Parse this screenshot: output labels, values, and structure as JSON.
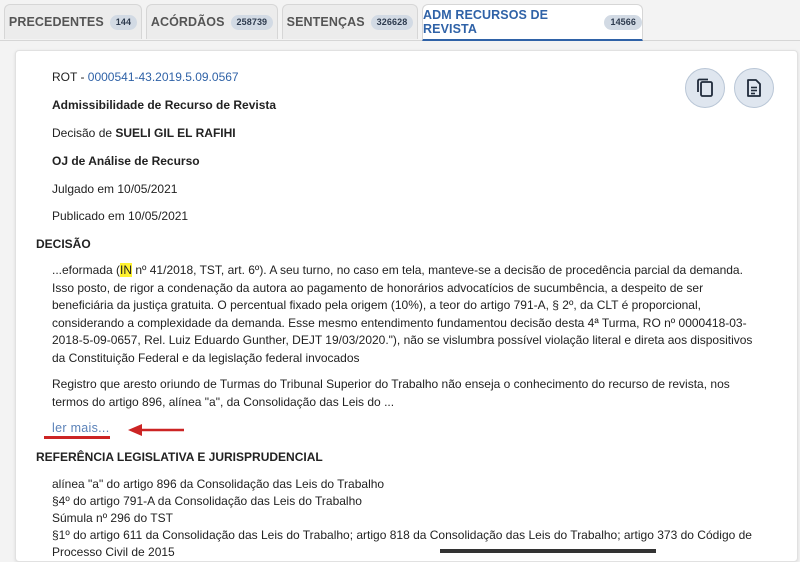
{
  "tabs": [
    {
      "label": "PRECEDENTES",
      "count": "144",
      "active": false
    },
    {
      "label": "ACÓRDÃOS",
      "count": "258739",
      "active": false
    },
    {
      "label": "SENTENÇAS",
      "count": "326628",
      "active": false
    },
    {
      "label": "ADM RECURSOS DE REVISTA",
      "count": "14566",
      "active": true
    }
  ],
  "record": {
    "rot_prefix": "ROT - ",
    "rot_number": "0000541-43.2019.5.09.0567",
    "type": "Admissibilidade de Recurso de Revista",
    "decision_prefix": "Decisão de ",
    "judge": "SUELI GIL EL RAFIHI",
    "oj": "OJ de Análise de Recurso",
    "judged": "Julgado em 10/05/2021",
    "published": "Publicado em 10/05/2021"
  },
  "decision": {
    "heading": "DECISÃO",
    "para1_before": "...eformada (",
    "para1_highlight": "IN",
    "para1_after": " nº 41/2018, TST, art. 6º). A seu turno, no caso em tela, manteve-se a decisão de procedência parcial da demanda. Isso posto, de rigor a condenação da autora ao pagamento de honorários advocatícios de sucumbência, a despeito de ser beneficiária da justiça gratuita. O percentual fixado pela origem (10%), a teor do artigo 791-A, § 2º, da CLT é proporcional, considerando a complexidade da demanda. Esse mesmo entendimento fundamentou decisão desta 4ª Turma, RO nº 0000418-03-2018-5-09-0657, Rel. Luiz Eduardo Gunther, DEJT 19/03/2020.\"), não se vislumbra possível violação literal e direta aos dispositivos da Constituição Federal e da legislação federal invocados",
    "para2": "Registro que aresto oriundo de Turmas do Tribunal Superior do Trabalho não enseja o conhecimento do recurso de revista, nos termos do artigo 896, alínea \"a\", da Consolidação das Leis do ...",
    "read_more": "ler mais..."
  },
  "references": {
    "heading": "REFERÊNCIA LEGISLATIVA E JURISPRUDENCIAL",
    "items": [
      "alínea \"a\" do artigo 896 da Consolidação das Leis do Trabalho",
      "§4º do artigo 791-A da Consolidação das Leis do Trabalho",
      "Súmula nº 296 do TST",
      "§1º do artigo 611 da Consolidação das Leis do Trabalho; artigo 818 da Consolidação das Leis do Trabalho; artigo 373 do Código de Processo Civil de 2015"
    ]
  },
  "icons": {
    "copy": "copy-icon",
    "document": "document-icon"
  },
  "colors": {
    "accent": "#2f62a7",
    "highlight": "#fff230",
    "annotation": "#cc2424"
  }
}
